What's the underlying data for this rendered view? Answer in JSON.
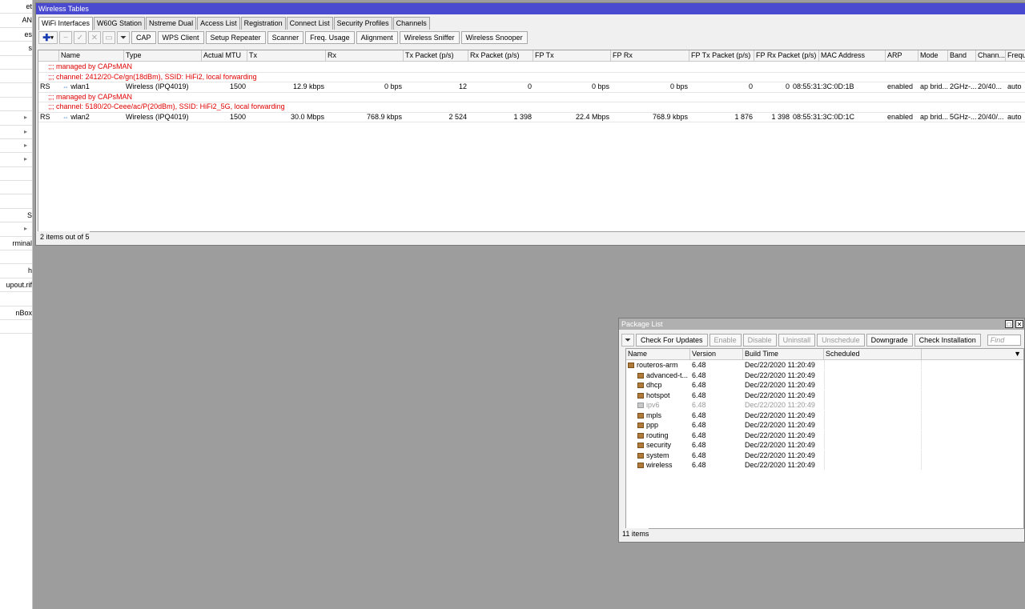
{
  "sidebar": {
    "items": [
      {
        "label": "et",
        "arrow": false
      },
      {
        "label": "AN",
        "arrow": false
      },
      {
        "label": "es",
        "arrow": false
      },
      {
        "label": "s",
        "arrow": false
      },
      {
        "label": "",
        "arrow": false
      },
      {
        "label": "",
        "arrow": false
      },
      {
        "label": "",
        "arrow": false
      },
      {
        "label": "",
        "arrow": false
      },
      {
        "label": "",
        "arrow": true
      },
      {
        "label": "",
        "arrow": true
      },
      {
        "label": "",
        "arrow": true
      },
      {
        "label": "",
        "arrow": true
      },
      {
        "label": "",
        "arrow": false
      },
      {
        "label": "",
        "arrow": false
      },
      {
        "label": "",
        "arrow": false
      },
      {
        "label": "S",
        "arrow": false
      },
      {
        "label": "",
        "arrow": true
      },
      {
        "label": "rminal",
        "arrow": false
      },
      {
        "label": "",
        "arrow": false
      },
      {
        "label": "h",
        "arrow": false
      },
      {
        "label": "upout.rif",
        "arrow": false
      },
      {
        "label": "",
        "arrow": false
      },
      {
        "label": "nBox",
        "arrow": false
      },
      {
        "label": "",
        "arrow": false
      }
    ]
  },
  "wireless": {
    "title": "Wireless Tables",
    "tabs": [
      "WiFi Interfaces",
      "W60G Station",
      "Nstreme Dual",
      "Access List",
      "Registration",
      "Connect List",
      "Security Profiles",
      "Channels"
    ],
    "buttons": [
      "CAP",
      "WPS Client",
      "Setup Repeater",
      "Scanner",
      "Freq. Usage",
      "Alignment",
      "Wireless Sniffer",
      "Wireless Snooper"
    ],
    "columns": [
      "",
      "Name",
      "Type",
      "Actual MTU",
      "Tx",
      "Rx",
      "Tx Packet (p/s)",
      "Rx Packet (p/s)",
      "FP Tx",
      "FP Rx",
      "FP Tx Packet (p/s)",
      "FP Rx Packet (p/s)",
      "MAC Address",
      "ARP",
      "Mode",
      "Band",
      "Chann...",
      "Frequ"
    ],
    "rows": [
      {
        "kind": "comment",
        "text": ";;; managed by CAPsMAN"
      },
      {
        "kind": "comment",
        "text": ";;; channel: 2412/20-Ce/gn(18dBm), SSID: HiFi2, local forwarding"
      },
      {
        "kind": "data",
        "flags": "RS",
        "name": "wlan1",
        "type": "Wireless (IPQ4019)",
        "mtu": "1500",
        "tx": "12.9 kbps",
        "rx": "0 bps",
        "txp": "12",
        "rxp": "0",
        "fptx": "0 bps",
        "fprx": "0 bps",
        "fptxp": "0",
        "fprxp": "0",
        "mac": "08:55:31:3C:0D:1B",
        "arp": "enabled",
        "mode": "ap brid...",
        "band": "2GHz-...",
        "chan": "20/40...",
        "freq": "auto"
      },
      {
        "kind": "comment",
        "text": ";;; managed by CAPsMAN"
      },
      {
        "kind": "comment",
        "text": ";;; channel: 5180/20-Ceee/ac/P(20dBm), SSID: HiFi2_5G, local forwarding"
      },
      {
        "kind": "data",
        "flags": "RS",
        "name": "wlan2",
        "type": "Wireless (IPQ4019)",
        "mtu": "1500",
        "tx": "30.0 Mbps",
        "rx": "768.9 kbps",
        "txp": "2 524",
        "rxp": "1 398",
        "fptx": "22.4 Mbps",
        "fprx": "768.9 kbps",
        "fptxp": "1 876",
        "fprxp": "1 398",
        "mac": "08:55:31:3C:0D:1C",
        "arp": "enabled",
        "mode": "ap brid...",
        "band": "5GHz-...",
        "chan": "20/40/...",
        "freq": "auto"
      }
    ],
    "status": "2 items out of 5"
  },
  "packages": {
    "title": "Package List",
    "buttons": [
      {
        "label": "Check For Updates",
        "disabled": false
      },
      {
        "label": "Enable",
        "disabled": true
      },
      {
        "label": "Disable",
        "disabled": true
      },
      {
        "label": "Uninstall",
        "disabled": true
      },
      {
        "label": "Unschedule",
        "disabled": true
      },
      {
        "label": "Downgrade",
        "disabled": false
      },
      {
        "label": "Check Installation",
        "disabled": false
      }
    ],
    "find_placeholder": "Find",
    "columns": [
      "Name",
      "Version",
      "Build Time",
      "Scheduled"
    ],
    "rows": [
      {
        "name": "routeros-arm",
        "version": "6.48",
        "build": "Dec/22/2020 11:20:49",
        "child": false,
        "disabled": false
      },
      {
        "name": "advanced-t...",
        "version": "6.48",
        "build": "Dec/22/2020 11:20:49",
        "child": true,
        "disabled": false
      },
      {
        "name": "dhcp",
        "version": "6.48",
        "build": "Dec/22/2020 11:20:49",
        "child": true,
        "disabled": false
      },
      {
        "name": "hotspot",
        "version": "6.48",
        "build": "Dec/22/2020 11:20:49",
        "child": true,
        "disabled": false
      },
      {
        "name": "ipv6",
        "version": "6.48",
        "build": "Dec/22/2020 11:20:49",
        "child": true,
        "disabled": true
      },
      {
        "name": "mpls",
        "version": "6.48",
        "build": "Dec/22/2020 11:20:49",
        "child": true,
        "disabled": false
      },
      {
        "name": "ppp",
        "version": "6.48",
        "build": "Dec/22/2020 11:20:49",
        "child": true,
        "disabled": false
      },
      {
        "name": "routing",
        "version": "6.48",
        "build": "Dec/22/2020 11:20:49",
        "child": true,
        "disabled": false
      },
      {
        "name": "security",
        "version": "6.48",
        "build": "Dec/22/2020 11:20:49",
        "child": true,
        "disabled": false
      },
      {
        "name": "system",
        "version": "6.48",
        "build": "Dec/22/2020 11:20:49",
        "child": true,
        "disabled": false
      },
      {
        "name": "wireless",
        "version": "6.48",
        "build": "Dec/22/2020 11:20:49",
        "child": true,
        "disabled": false
      }
    ],
    "status": "11 items"
  },
  "colors": {
    "title_active": "#4a4ad0",
    "title_inactive": "#b0b0b0",
    "comment": "#e00000"
  }
}
